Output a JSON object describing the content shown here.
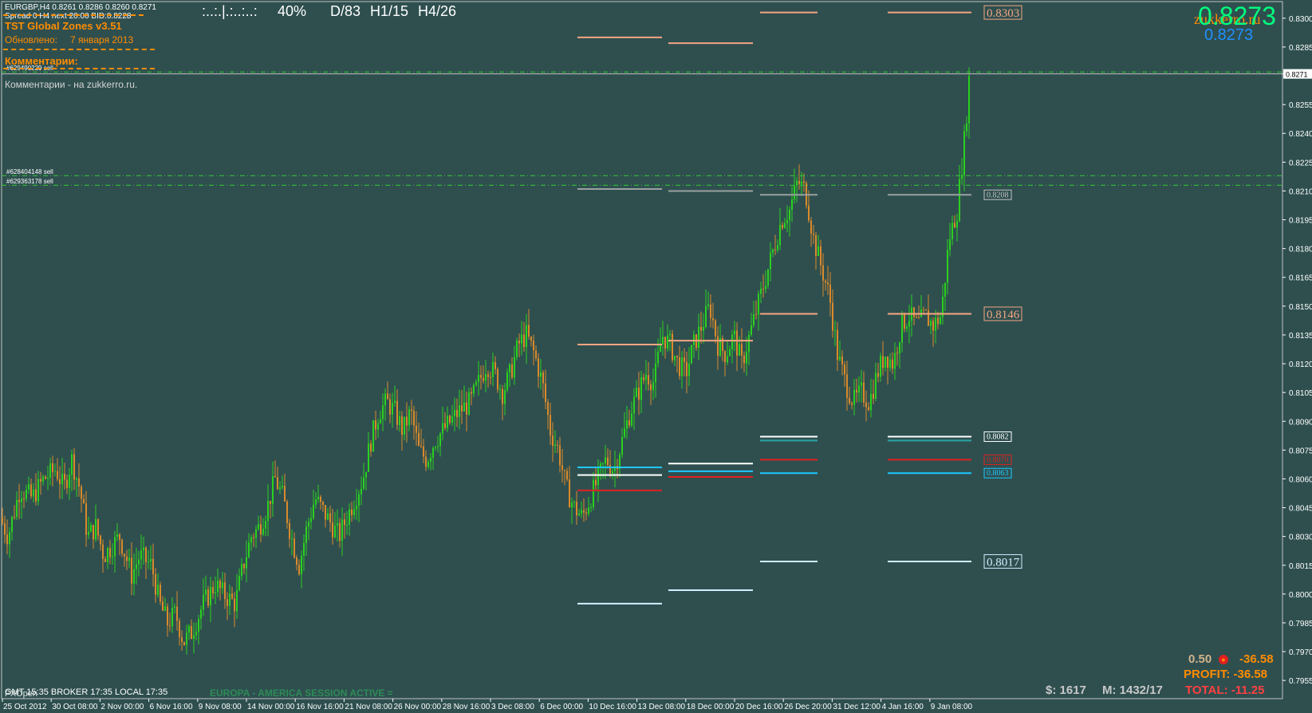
{
  "symbol_info": "EURGBP,H4  0.8261 0.8286 0.8260 0.8271",
  "spread_info": "Spread 0  H4 next 20:00 BID:0.8228",
  "indicator": {
    "title": "TST Global Zones  v3.51",
    "updated_label": "Обновлено:",
    "updated_date": "7 января 2013",
    "comments_label": "Комментарии:",
    "comments_text": "Комментарии - на zukkerro.ru."
  },
  "top_info": {
    "bar": ":..:.|.:..:..:",
    "percent": "40%",
    "d": "D/83",
    "h1": "H1/15",
    "h4": "H4/26"
  },
  "price_big": "0.8273",
  "price_small": "0.8273",
  "watermark": "zukkerro.ru",
  "orders": [
    {
      "label": "#629490229 sell",
      "price": 0.8272
    },
    {
      "label": "#628404148 sell",
      "price": 0.8218
    },
    {
      "label": "#629363178 sell",
      "price": 0.8213
    }
  ],
  "current_price": {
    "price": 0.8271,
    "label": "0.8271"
  },
  "zone_labels": [
    {
      "text": "0.8303",
      "price": 0.8303,
      "color": "#f4a582",
      "big": true
    },
    {
      "text": "0.8208",
      "price": 0.8208,
      "color": "#c0c0c0",
      "big": false
    },
    {
      "text": "0.8146",
      "price": 0.8146,
      "color": "#f4a582",
      "big": true
    },
    {
      "text": "0.8082",
      "price": 0.8082,
      "color": "#ffffff",
      "big": false
    },
    {
      "text": "0.8070",
      "price": 0.807,
      "color": "#e02020",
      "big": false
    },
    {
      "text": "0.8063",
      "price": 0.8063,
      "color": "#1ec8ff",
      "big": false
    },
    {
      "text": "0.8017",
      "price": 0.8017,
      "color": "#cfefff",
      "big": true
    }
  ],
  "y_axis": {
    "min": 0.7948,
    "max": 0.8307,
    "ticks": [
      "0.8300",
      "0.8285",
      "0.8271",
      "0.8255",
      "0.8240",
      "0.8225",
      "0.8210",
      "0.8195",
      "0.8180",
      "0.8165",
      "0.8150",
      "0.8135",
      "0.8120",
      "0.8105",
      "0.8090",
      "0.8075",
      "0.8060",
      "0.8045",
      "0.8030",
      "0.8015",
      "0.8000",
      "0.7985",
      "0.7970",
      "0.7955"
    ]
  },
  "x_axis": {
    "labels": [
      "25 Oct 2012",
      "30 Oct 08:00",
      "2 Nov 00:00",
      "6 Nov 16:00",
      "9 Nov 08:00",
      "14 Nov 00:00",
      "16 Nov 16:00",
      "21 Nov 08:00",
      "26 Nov 00:00",
      "28 Nov 16:00",
      "3 Dec 08:00",
      "6 Dec 00:00",
      "10 Dec 16:00",
      "13 Dec 08:00",
      "18 Dec 00:00",
      "20 Dec 16:00",
      "26 Dec 20:00",
      "31 Dec 12:00",
      "4 Jan 16:00",
      "9 Jan 08:00"
    ]
  },
  "footer": {
    "copyright": "FXOpen",
    "session": "EUROPA - AMERICA SESSION ACTIVE =",
    "time_info": "GMT 15:35  BROKER 17:35  LOCAL 17:35",
    "lot": "0.50",
    "lot_value": "-36.58",
    "profit_label": "PROFIT: -36.58",
    "balance": "$: 1617",
    "margin": "M: 1432/17",
    "total": "TOTAL: -11.25"
  },
  "colors": {
    "background": "#2f4f4f",
    "bull": "#2ad11f",
    "bear": "#d98a2b",
    "order_line": "#32cd32",
    "axis_text": "#ffffff"
  },
  "chart_data": {
    "type": "candlestick",
    "symbol": "EURGBP",
    "timeframe": "H4",
    "ylim": [
      0.7948,
      0.8307
    ],
    "path_points": [
      [
        0,
        0.804
      ],
      [
        10,
        0.803
      ],
      [
        25,
        0.8055
      ],
      [
        40,
        0.805
      ],
      [
        55,
        0.806
      ],
      [
        70,
        0.8065
      ],
      [
        80,
        0.8055
      ],
      [
        90,
        0.807
      ],
      [
        100,
        0.8055
      ],
      [
        110,
        0.803
      ],
      [
        120,
        0.8035
      ],
      [
        130,
        0.802
      ],
      [
        150,
        0.803
      ],
      [
        165,
        0.801
      ],
      [
        175,
        0.802
      ],
      [
        190,
        0.8015
      ],
      [
        200,
        0.7995
      ],
      [
        210,
        0.7985
      ],
      [
        220,
        0.799
      ],
      [
        230,
        0.7975
      ],
      [
        240,
        0.798
      ],
      [
        255,
        0.7995
      ],
      [
        270,
        0.8005
      ],
      [
        280,
        0.8
      ],
      [
        295,
        0.7995
      ],
      [
        305,
        0.8015
      ],
      [
        315,
        0.803
      ],
      [
        325,
        0.8035
      ],
      [
        335,
        0.8045
      ],
      [
        345,
        0.806
      ],
      [
        355,
        0.805
      ],
      [
        365,
        0.803
      ],
      [
        375,
        0.8015
      ],
      [
        385,
        0.8035
      ],
      [
        395,
        0.805
      ],
      [
        410,
        0.804
      ],
      [
        425,
        0.803
      ],
      [
        440,
        0.8045
      ],
      [
        455,
        0.806
      ],
      [
        465,
        0.808
      ],
      [
        475,
        0.8095
      ],
      [
        485,
        0.81
      ],
      [
        495,
        0.8095
      ],
      [
        505,
        0.8085
      ],
      [
        515,
        0.8095
      ],
      [
        525,
        0.8075
      ],
      [
        535,
        0.807
      ],
      [
        545,
        0.808
      ],
      [
        555,
        0.8085
      ],
      [
        565,
        0.809
      ],
      [
        575,
        0.8095
      ],
      [
        590,
        0.81
      ],
      [
        600,
        0.811
      ],
      [
        610,
        0.812
      ],
      [
        620,
        0.8115
      ],
      [
        630,
        0.8105
      ],
      [
        640,
        0.8115
      ],
      [
        650,
        0.813
      ],
      [
        660,
        0.8135
      ],
      [
        670,
        0.8125
      ],
      [
        680,
        0.811
      ],
      [
        690,
        0.8085
      ],
      [
        700,
        0.8075
      ],
      [
        710,
        0.8055
      ],
      [
        720,
        0.8045
      ],
      [
        730,
        0.804
      ],
      [
        740,
        0.805
      ],
      [
        750,
        0.806
      ],
      [
        760,
        0.807
      ],
      [
        770,
        0.8065
      ],
      [
        780,
        0.808
      ],
      [
        790,
        0.8095
      ],
      [
        800,
        0.8105
      ],
      [
        810,
        0.8115
      ],
      [
        820,
        0.811
      ],
      [
        830,
        0.8135
      ],
      [
        840,
        0.813
      ],
      [
        850,
        0.812
      ],
      [
        860,
        0.8115
      ],
      [
        870,
        0.813
      ],
      [
        880,
        0.814
      ],
      [
        890,
        0.815
      ],
      [
        900,
        0.813
      ],
      [
        910,
        0.8125
      ],
      [
        920,
        0.8135
      ],
      [
        930,
        0.812
      ],
      [
        940,
        0.8135
      ],
      [
        950,
        0.815
      ],
      [
        960,
        0.8165
      ],
      [
        970,
        0.818
      ],
      [
        980,
        0.8195
      ],
      [
        990,
        0.82
      ],
      [
        1000,
        0.8215
      ],
      [
        1010,
        0.821
      ],
      [
        1020,
        0.8185
      ],
      [
        1030,
        0.817
      ],
      [
        1040,
        0.8155
      ],
      [
        1050,
        0.8125
      ],
      [
        1060,
        0.811
      ],
      [
        1070,
        0.81
      ],
      [
        1080,
        0.8105
      ],
      [
        1090,
        0.81
      ],
      [
        1100,
        0.8115
      ],
      [
        1110,
        0.8125
      ],
      [
        1120,
        0.812
      ],
      [
        1130,
        0.814
      ],
      [
        1140,
        0.8145
      ],
      [
        1150,
        0.814
      ],
      [
        1160,
        0.8145
      ],
      [
        1170,
        0.814
      ],
      [
        1180,
        0.8145
      ],
      [
        1190,
        0.8185
      ],
      [
        1200,
        0.82
      ],
      [
        1210,
        0.824
      ],
      [
        1215,
        0.8268
      ],
      [
        1218,
        0.8271
      ]
    ],
    "zone_segments": [
      {
        "x1": 724,
        "x2": 830,
        "price": 0.829,
        "color": "#f4a582"
      },
      {
        "x1": 838,
        "x2": 944,
        "price": 0.8287,
        "color": "#f4a582"
      },
      {
        "x1": 953,
        "x2": 1025,
        "price": 0.8303,
        "color": "#f4a582"
      },
      {
        "x1": 1113,
        "x2": 1218,
        "price": 0.8303,
        "color": "#f4a582"
      },
      {
        "x1": 724,
        "x2": 830,
        "price": 0.813,
        "color": "#f4a582"
      },
      {
        "x1": 838,
        "x2": 944,
        "price": 0.8132,
        "color": "#f4a582"
      },
      {
        "x1": 953,
        "x2": 1025,
        "price": 0.8146,
        "color": "#f4a582"
      },
      {
        "x1": 1113,
        "x2": 1218,
        "price": 0.8146,
        "color": "#f4a582"
      },
      {
        "x1": 724,
        "x2": 830,
        "price": 0.8066,
        "color": "#1ec8ff"
      },
      {
        "x1": 724,
        "x2": 830,
        "price": 0.8062,
        "color": "#ffffff"
      },
      {
        "x1": 724,
        "x2": 830,
        "price": 0.8054,
        "color": "#e02020"
      },
      {
        "x1": 838,
        "x2": 944,
        "price": 0.8068,
        "color": "#ffffff"
      },
      {
        "x1": 838,
        "x2": 944,
        "price": 0.8064,
        "color": "#1ec8ff"
      },
      {
        "x1": 838,
        "x2": 944,
        "price": 0.8061,
        "color": "#e02020"
      },
      {
        "x1": 953,
        "x2": 1025,
        "price": 0.8082,
        "color": "#ffffff"
      },
      {
        "x1": 953,
        "x2": 1025,
        "price": 0.808,
        "color": "#2aa6a6"
      },
      {
        "x1": 953,
        "x2": 1025,
        "price": 0.807,
        "color": "#e02020"
      },
      {
        "x1": 953,
        "x2": 1025,
        "price": 0.8063,
        "color": "#1ec8ff"
      },
      {
        "x1": 1113,
        "x2": 1218,
        "price": 0.8082,
        "color": "#ffffff"
      },
      {
        "x1": 1113,
        "x2": 1218,
        "price": 0.808,
        "color": "#2aa6a6"
      },
      {
        "x1": 1113,
        "x2": 1218,
        "price": 0.807,
        "color": "#e02020"
      },
      {
        "x1": 1113,
        "x2": 1218,
        "price": 0.8063,
        "color": "#1ec8ff"
      },
      {
        "x1": 724,
        "x2": 830,
        "price": 0.7995,
        "color": "#cfefff"
      },
      {
        "x1": 838,
        "x2": 944,
        "price": 0.8002,
        "color": "#cfefff"
      },
      {
        "x1": 953,
        "x2": 1025,
        "price": 0.8017,
        "color": "#cfefff"
      },
      {
        "x1": 1113,
        "x2": 1218,
        "price": 0.8017,
        "color": "#cfefff"
      },
      {
        "x1": 724,
        "x2": 830,
        "price": 0.8211,
        "color": "#9aa0a0"
      },
      {
        "x1": 838,
        "x2": 944,
        "price": 0.821,
        "color": "#9aa0a0"
      },
      {
        "x1": 953,
        "x2": 1025,
        "price": 0.8208,
        "color": "#9aa0a0"
      },
      {
        "x1": 1113,
        "x2": 1218,
        "price": 0.8208,
        "color": "#9aa0a0"
      }
    ]
  }
}
